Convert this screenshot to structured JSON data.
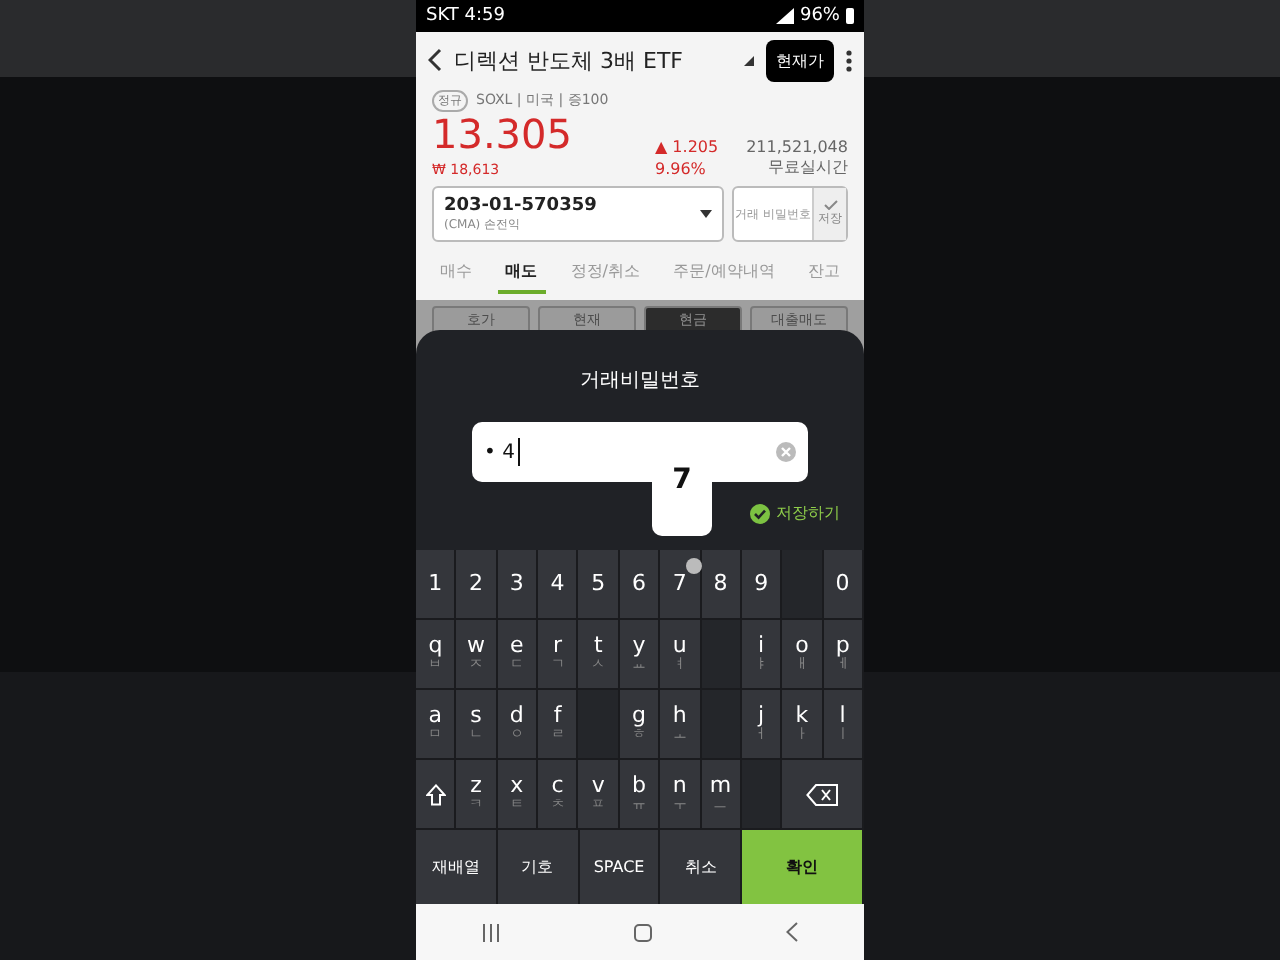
{
  "status_bar": {
    "carrier_time": "SKT 4:59",
    "battery": "96%"
  },
  "header": {
    "title": "디렉션 반도체 3배 ETF",
    "price_button": "현재가"
  },
  "stock": {
    "session_badge": "정규",
    "info": "SOXL | 미국 | 증100",
    "price": "13.305",
    "krw_price": "₩ 18,613",
    "change": "▲ 1.205",
    "change_rate": "9.96%",
    "volume": "211,521,048",
    "realtime": "무료실시간"
  },
  "account": {
    "number": "203-01-570359",
    "type": "(CMA) 손전익",
    "password_button": "거래 비밀번호",
    "save": {
      "label": "저장",
      "checked": true
    }
  },
  "tabs": [
    {
      "label": "매수",
      "selected": false
    },
    {
      "label": "매도",
      "selected": true
    },
    {
      "label": "정정/취소",
      "selected": false
    },
    {
      "label": "주문/예약내역",
      "selected": false
    },
    {
      "label": "잔고",
      "selected": false
    }
  ],
  "order_options": [
    {
      "label": "호가",
      "selected": false
    },
    {
      "label": "현재",
      "selected": false
    },
    {
      "label": "현금",
      "selected": true
    },
    {
      "label": "대출매도",
      "selected": false
    }
  ],
  "password_sheet": {
    "title": "거래비밀번호",
    "value": "• 4",
    "save_option": {
      "label": "저장하기",
      "checked": true
    }
  },
  "keyboard": {
    "popup": "7",
    "rows": [
      [
        {
          "kind": "char",
          "label": "1"
        },
        {
          "kind": "char",
          "label": "2"
        },
        {
          "kind": "char",
          "label": "3"
        },
        {
          "kind": "char",
          "label": "4"
        },
        {
          "kind": "char",
          "label": "5"
        },
        {
          "kind": "char",
          "label": "6"
        },
        {
          "kind": "char",
          "label": "7",
          "pressed": true
        },
        {
          "kind": "char",
          "label": "8"
        },
        {
          "kind": "char",
          "label": "9"
        },
        {
          "kind": "blank"
        },
        {
          "kind": "char",
          "label": "0"
        }
      ],
      [
        {
          "kind": "char",
          "label": "q",
          "sub": "ㅂ"
        },
        {
          "kind": "char",
          "label": "w",
          "sub": "ㅈ"
        },
        {
          "kind": "char",
          "label": "e",
          "sub": "ㄷ"
        },
        {
          "kind": "char",
          "label": "r",
          "sub": "ㄱ"
        },
        {
          "kind": "char",
          "label": "t",
          "sub": "ㅅ"
        },
        {
          "kind": "char",
          "label": "y",
          "sub": "ㅛ"
        },
        {
          "kind": "char",
          "label": "u",
          "sub": "ㅕ"
        },
        {
          "kind": "blank"
        },
        {
          "kind": "char",
          "label": "i",
          "sub": "ㅑ"
        },
        {
          "kind": "char",
          "label": "o",
          "sub": "ㅐ"
        },
        {
          "kind": "char",
          "label": "p",
          "sub": "ㅔ"
        }
      ],
      [
        {
          "kind": "char",
          "label": "a",
          "sub": "ㅁ"
        },
        {
          "kind": "char",
          "label": "s",
          "sub": "ㄴ"
        },
        {
          "kind": "char",
          "label": "d",
          "sub": "ㅇ"
        },
        {
          "kind": "char",
          "label": "f",
          "sub": "ㄹ"
        },
        {
          "kind": "blank"
        },
        {
          "kind": "char",
          "label": "g",
          "sub": "ㅎ"
        },
        {
          "kind": "char",
          "label": "h",
          "sub": "ㅗ"
        },
        {
          "kind": "blank"
        },
        {
          "kind": "char",
          "label": "j",
          "sub": "ㅓ"
        },
        {
          "kind": "char",
          "label": "k",
          "sub": "ㅏ"
        },
        {
          "kind": "char",
          "label": "l",
          "sub": "ㅣ"
        }
      ],
      [
        {
          "kind": "shift"
        },
        {
          "kind": "char",
          "label": "z",
          "sub": "ㅋ"
        },
        {
          "kind": "char",
          "label": "x",
          "sub": "ㅌ"
        },
        {
          "kind": "char",
          "label": "c",
          "sub": "ㅊ"
        },
        {
          "kind": "char",
          "label": "v",
          "sub": "ㅍ"
        },
        {
          "kind": "char",
          "label": "b",
          "sub": "ㅠ"
        },
        {
          "kind": "char",
          "label": "n",
          "sub": "ㅜ"
        },
        {
          "kind": "char",
          "label": "m",
          "sub": "ㅡ"
        },
        {
          "kind": "blank"
        },
        {
          "kind": "backspace"
        }
      ]
    ],
    "bottom": [
      {
        "kind": "action",
        "label": "재배열"
      },
      {
        "kind": "action",
        "label": "기호"
      },
      {
        "kind": "action",
        "label": "SPACE"
      },
      {
        "kind": "action",
        "label": "취소"
      },
      {
        "kind": "confirm",
        "label": "확인"
      }
    ]
  }
}
